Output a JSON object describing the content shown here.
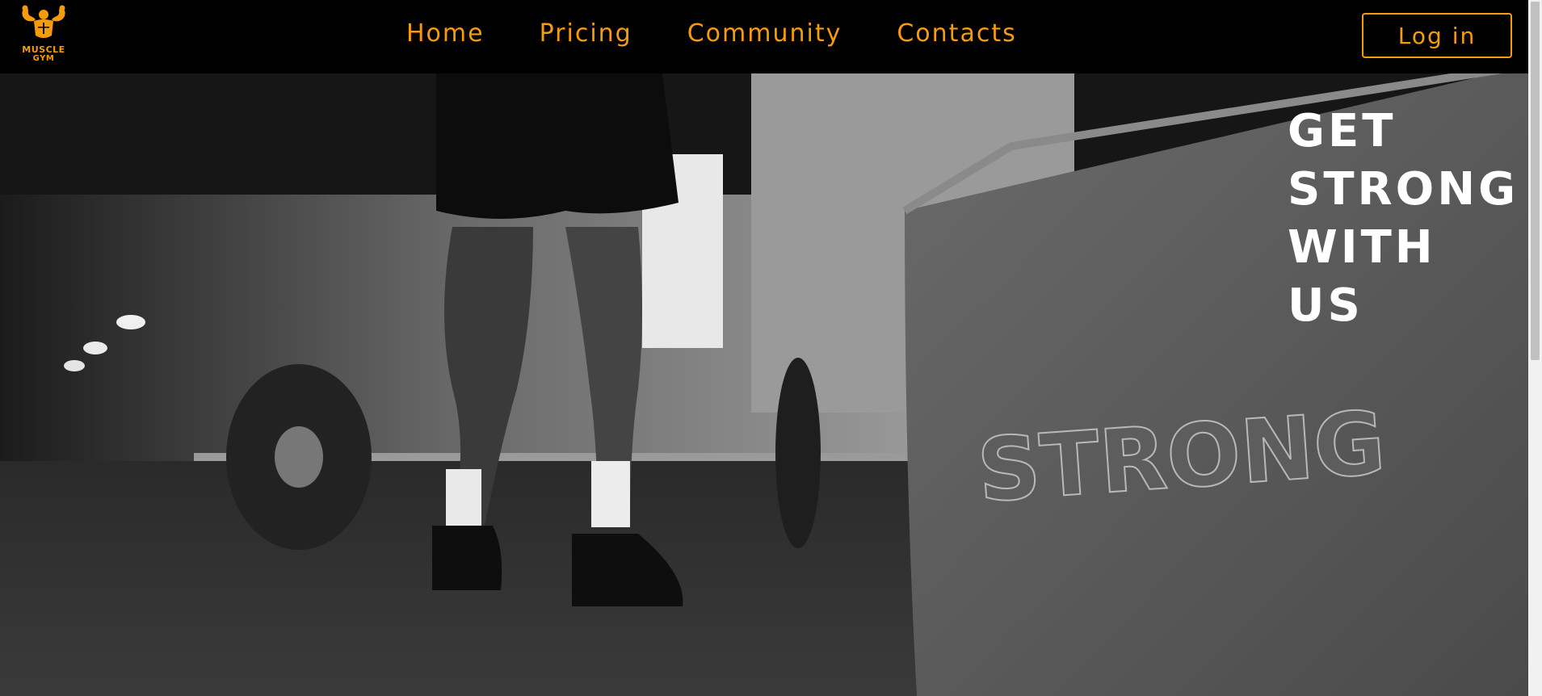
{
  "brand": {
    "logo_line1": "MUSCLE",
    "logo_line2": "GYM",
    "accent_color": "#f59b0c"
  },
  "nav": {
    "items": [
      {
        "label": "Home"
      },
      {
        "label": "Pricing"
      },
      {
        "label": "Community"
      },
      {
        "label": "Contacts"
      }
    ],
    "login_label": "Log in"
  },
  "hero": {
    "title": "GET STRONG WITH US",
    "box_engraving": "STRONG"
  },
  "icons": {
    "logo": "flexing-bodybuilder-icon"
  }
}
